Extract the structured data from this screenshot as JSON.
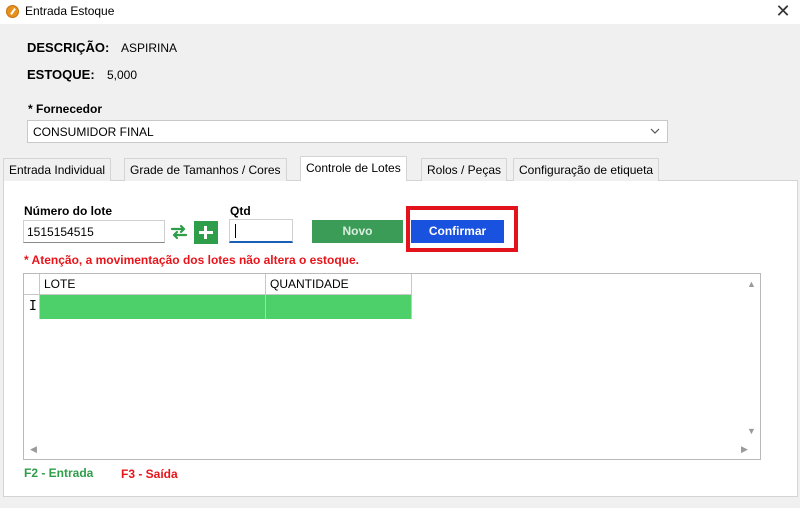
{
  "window": {
    "title": "Entrada Estoque",
    "close_glyph": "✕"
  },
  "product": {
    "descricao_label": "DESCRIÇÃO:",
    "descricao_value": "ASPIRINA",
    "estoque_label": "ESTOQUE:",
    "estoque_value": "5,000"
  },
  "fornecedor": {
    "label": "* Fornecedor",
    "selected": "CONSUMIDOR FINAL"
  },
  "tabs": [
    {
      "label": "Entrada Individual",
      "active": false
    },
    {
      "label": "Grade de Tamanhos / Cores",
      "active": false
    },
    {
      "label": "Controle de Lotes",
      "active": true
    },
    {
      "label": "Rolos / Peças",
      "active": false
    },
    {
      "label": "Configuração de etiqueta",
      "active": false
    }
  ],
  "lotes": {
    "numero_label": "Número do lote",
    "numero_value": "1515154515",
    "qtd_label": "Qtd",
    "qtd_value": "",
    "novo_label": "Novo",
    "confirmar_label": "Confirmar",
    "warning": "* Atenção, a movimentação dos lotes não altera o estoque.",
    "grid": {
      "columns": [
        "LOTE",
        "QUANTIDADE"
      ],
      "rows": [
        [
          "",
          ""
        ]
      ]
    }
  },
  "shortcuts": {
    "f2": "F2 - Entrada",
    "f3": "F3 - Saída"
  },
  "colors": {
    "accent_blue": "#1a52e0",
    "green": "#2e9e4a",
    "row_green": "#4dd06a",
    "warning_red": "#e8141a",
    "highlight_red": "#e3131e"
  },
  "icons": [
    "app-icon",
    "close-icon",
    "chevron-down-icon",
    "swap-icon",
    "plus-icon",
    "text-cursor-icon"
  ]
}
